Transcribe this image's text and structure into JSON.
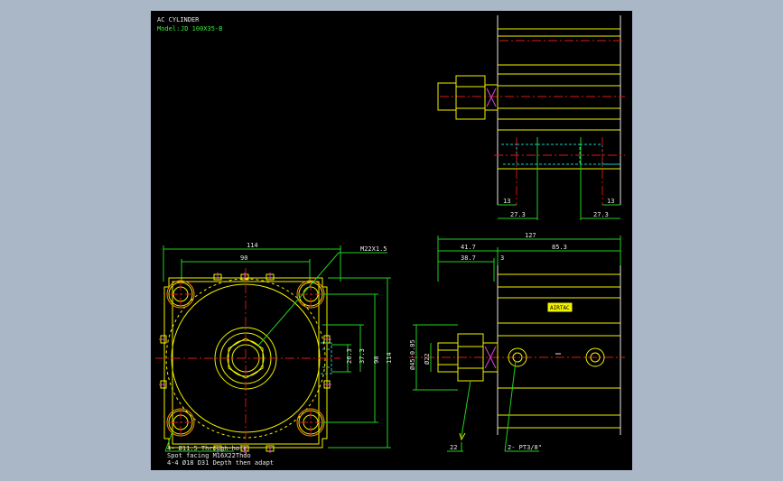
{
  "header": {
    "title": "AC CYLINDER",
    "model_label": "Model:",
    "model_value": "JD 100X35-B"
  },
  "front_view": {
    "top_width": "114",
    "hole_pitch": "90",
    "port_thread": "M22X1.5",
    "height_port": "26.3",
    "height_center": "37.3",
    "height_pitch": "90",
    "height_total": "114",
    "mount_note_1": "4- Ø11.5 Through-hole",
    "mount_note_2": "Spot facing  M16X22Thdo",
    "mount_note_3": "4-4 Ø18 D31 Depth then adapt"
  },
  "side_view": {
    "total_length": "127",
    "rod_length": "41.7",
    "body_length": "85.3",
    "cap_length": "38.7",
    "gap": "3",
    "rod_dia": "Ø22",
    "bore_dia": "Ø45-0.05",
    "wrench": "22",
    "port_note": "2- PT3/8\"",
    "label": "AIRTAC"
  },
  "top_view": {
    "dim_left_small": "13",
    "dim_left_large": "27.3",
    "dim_right_small": "13",
    "dim_right_large": "27.3"
  }
}
